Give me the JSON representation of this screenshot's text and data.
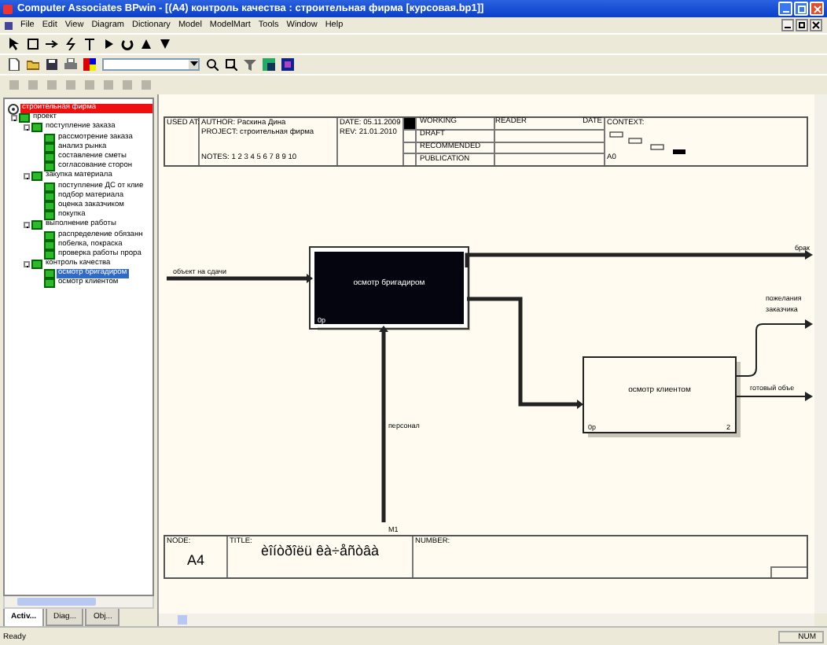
{
  "window": {
    "title": "Computer Associates BPwin - [(A4) контроль качества : строительная фирма [курсовая.bp1]]"
  },
  "menu": [
    "File",
    "Edit",
    "View",
    "Diagram",
    "Dictionary",
    "Model",
    "ModelMart",
    "Tools",
    "Window",
    "Help"
  ],
  "tree": {
    "root": {
      "label": "строительная фирма"
    },
    "children": [
      {
        "label": "проект",
        "expanded": true,
        "selected": false,
        "children": [
          {
            "label": "поступление заказа",
            "expanded": true,
            "selected": false,
            "children": [
              {
                "label": "рассмотрение заказа",
                "selected": false
              },
              {
                "label": "анализ рынка",
                "selected": false
              },
              {
                "label": "составление сметы",
                "selected": false
              },
              {
                "label": "согласование сторон",
                "selected": false
              }
            ]
          },
          {
            "label": "закупка материала",
            "expanded": true,
            "selected": false,
            "children": [
              {
                "label": "поступление ДС от клие",
                "selected": false
              },
              {
                "label": "подбор материала",
                "selected": false
              },
              {
                "label": "оценка заказчиком",
                "selected": false
              },
              {
                "label": "покупка",
                "selected": false
              }
            ]
          },
          {
            "label": "выполнение работы",
            "expanded": true,
            "selected": false,
            "children": [
              {
                "label": "распределение обязанн",
                "selected": false
              },
              {
                "label": "побелка, покраска",
                "selected": false
              },
              {
                "label": "проверка работы прора",
                "selected": false
              }
            ]
          },
          {
            "label": "контроль качества",
            "expanded": true,
            "selected": false,
            "children": [
              {
                "label": "осмотр бригадиром",
                "selected": true
              },
              {
                "label": "осмотр клиентом",
                "selected": false
              }
            ]
          }
        ]
      }
    ]
  },
  "panel_tabs": [
    {
      "label": "Activ...",
      "selected": true
    },
    {
      "label": "Diag...",
      "selected": false
    },
    {
      "label": "Obj...",
      "selected": false
    }
  ],
  "header": {
    "used_at": "USED AT:",
    "author": "AUTHOR:  Раскина Дина",
    "project": "PROJECT:  строительная фирма",
    "notes": "NOTES:  1  2  3  4  5  6  7  8  9  10",
    "date": "DATE:  05.11.2009",
    "rev": "REV:     21.01.2010",
    "statuses": [
      {
        "label": "WORKING",
        "checked": true
      },
      {
        "label": "DRAFT",
        "checked": false
      },
      {
        "label": "RECOMMENDED",
        "checked": false
      },
      {
        "label": "PUBLICATION",
        "checked": false
      }
    ],
    "reader": "READER",
    "reader_date": "DATE",
    "context": "CONTEXT:",
    "context_node": "A0"
  },
  "diagram": {
    "boxes": [
      {
        "label": "осмотр бригадиром",
        "cost": "0р",
        "selected": true
      },
      {
        "label": "осмотр клиентом",
        "cost": "0р",
        "number": "2",
        "selected": false
      }
    ],
    "arrows": [
      {
        "label": "объект на сдачи"
      },
      {
        "label": "брак"
      },
      {
        "label": "персонал"
      },
      {
        "label": "M1"
      },
      {
        "label": "пожелания заказчика"
      },
      {
        "label": "готовый объе"
      }
    ]
  },
  "footer": {
    "node_label": "NODE:",
    "node": "A4",
    "title_label": "TITLE:",
    "title": "èîíòðîëü êà÷åñòâà",
    "number_label": "NUMBER:"
  },
  "status_bar": {
    "text": "Ready",
    "num": "NUM"
  }
}
